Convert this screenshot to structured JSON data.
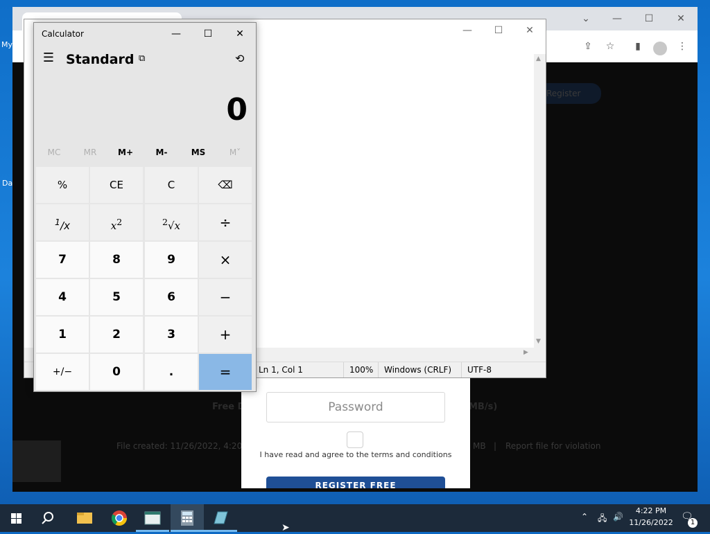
{
  "desktop": {
    "icons": [
      {
        "label": "My"
      },
      {
        "label": "Da"
      }
    ]
  },
  "browser": {
    "page": {
      "register_link": "Register",
      "free_download_partial": "Free D",
      "speed_partial": "MB/s)",
      "file_created": "File created: 11/26/2022, 4:20:0",
      "size_partial": "MB",
      "separator": "|",
      "report": "Report file for violation",
      "password_placeholder": "Password",
      "agree_text": "I have read and agree to the terms and conditions",
      "register_button": "REGISTER FREE"
    }
  },
  "notepad": {
    "status": {
      "position": "Ln 1, Col 1",
      "zoom": "100%",
      "line_ending": "Windows (CRLF)",
      "encoding": "UTF-8"
    }
  },
  "calculator": {
    "window_title": "Calculator",
    "mode": "Standard",
    "display": "0",
    "memory": [
      {
        "label": "MC",
        "enabled": false
      },
      {
        "label": "MR",
        "enabled": false
      },
      {
        "label": "M+",
        "enabled": true
      },
      {
        "label": "M-",
        "enabled": true
      },
      {
        "label": "MS",
        "enabled": true
      },
      {
        "label": "M˅",
        "enabled": false
      }
    ],
    "keys": {
      "percent": "%",
      "ce": "CE",
      "c": "C",
      "k7": "7",
      "k8": "8",
      "k9": "9",
      "k4": "4",
      "k5": "5",
      "k6": "6",
      "k1": "1",
      "k2": "2",
      "k3": "3",
      "negate": "+/−",
      "k0": "0",
      "decimal": "."
    }
  },
  "taskbar": {
    "time": "4:22 PM",
    "date": "11/26/2022",
    "notification_count": "1"
  }
}
